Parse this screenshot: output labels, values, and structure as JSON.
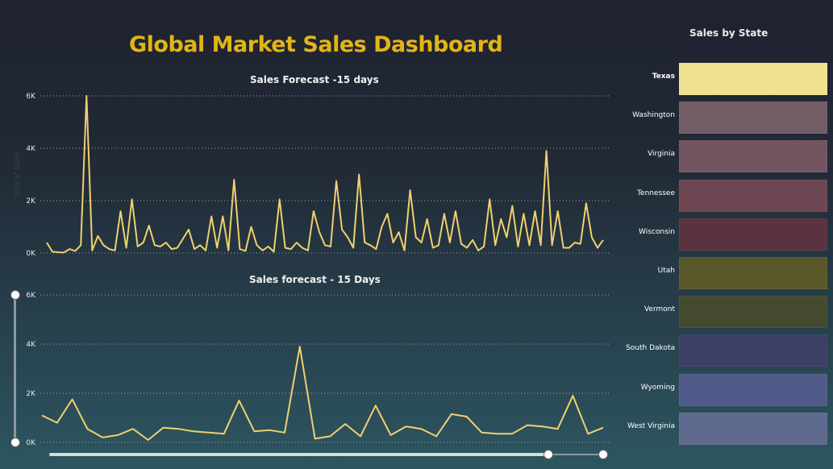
{
  "dashboard": {
    "title": "Global Market Sales Dashboard"
  },
  "chart_data": [
    {
      "type": "line",
      "title": "Sales Forecast -15 days",
      "ylabel": "Sum of Sales",
      "ylim": [
        0,
        6000
      ],
      "yticks": [
        "0K",
        "2K",
        "4K",
        "6K"
      ],
      "ytick_values": [
        0,
        2000,
        4000,
        6000
      ],
      "grid": true,
      "values": [
        400,
        50,
        30,
        20,
        150,
        80,
        300,
        6000,
        100,
        650,
        300,
        150,
        100,
        1600,
        200,
        2050,
        250,
        400,
        1050,
        300,
        250,
        400,
        150,
        200,
        550,
        900,
        150,
        300,
        100,
        1400,
        200,
        1400,
        100,
        2800,
        150,
        80,
        1000,
        300,
        100,
        250,
        50,
        2050,
        200,
        150,
        400,
        200,
        100,
        1600,
        800,
        300,
        250,
        2750,
        900,
        600,
        200,
        3000,
        400,
        300,
        150,
        1000,
        1500,
        400,
        800,
        100,
        2400,
        600,
        400,
        1300,
        200,
        300,
        1500,
        400,
        1600,
        350,
        200,
        500,
        100,
        250,
        2050,
        300,
        1300,
        600,
        1800,
        250,
        1500,
        300,
        1600,
        300,
        3900,
        300,
        1600,
        200,
        200,
        400,
        350,
        1900,
        600,
        200,
        500
      ],
      "series": [
        {
          "name": "Sales",
          "color": "#f0d06e"
        }
      ]
    },
    {
      "type": "line",
      "title": "Sales forecast - 15 Days",
      "ylim": [
        0,
        6000
      ],
      "yticks": [
        "0K",
        "2K",
        "4K",
        "6K"
      ],
      "ytick_values": [
        0,
        2000,
        4000,
        6000
      ],
      "grid": true,
      "values": [
        1100,
        800,
        1750,
        550,
        200,
        300,
        550,
        100,
        600,
        550,
        450,
        400,
        350,
        1700,
        450,
        500,
        400,
        3900,
        150,
        250,
        750,
        250,
        1500,
        300,
        650,
        550,
        250,
        1150,
        1050,
        400,
        350,
        350,
        700,
        650,
        550,
        1900,
        350,
        600
      ],
      "series": [
        {
          "name": "Sales",
          "color": "#f0d06e"
        }
      ]
    },
    {
      "type": "heatmap",
      "title": "Sales by State",
      "categories": [
        "Texas",
        "Washington",
        "Virginia",
        "Tennessee",
        "Wisconsin",
        "Utah",
        "Vermont",
        "South Dakota",
        "Wyoming",
        "West Virginia"
      ],
      "colors": [
        "#f0e291",
        "#725c65",
        "#725560",
        "#6e4652",
        "#5a3240",
        "#595828",
        "#444a2e",
        "#3c4066",
        "#515b89",
        "#5d6a8e"
      ]
    }
  ]
}
